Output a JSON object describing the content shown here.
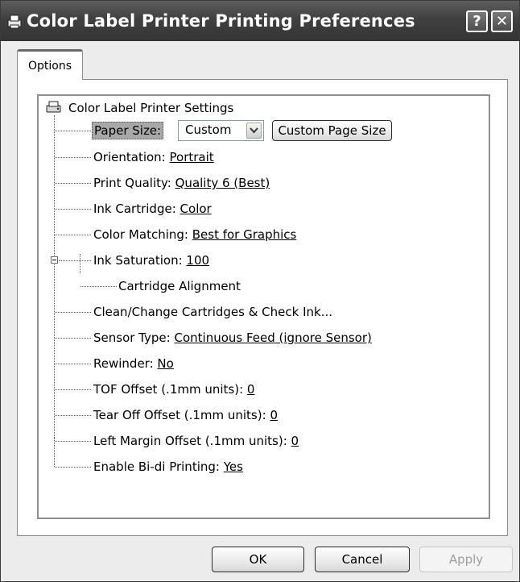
{
  "window": {
    "title": "Color Label Printer Printing Preferences",
    "help_button": "?",
    "close_button": "✕"
  },
  "tabs": [
    {
      "label": "Options",
      "active": true
    }
  ],
  "tree": {
    "root_label": "Color Label Printer Settings",
    "paper_size": {
      "label": "Paper Size:",
      "value": "Custom",
      "custom_button": "Custom Page Size"
    },
    "items": [
      {
        "label": "Orientation:",
        "value": "Portrait"
      },
      {
        "label": "Print Quality:",
        "value": "Quality 6 (Best)"
      },
      {
        "label": "Ink Cartridge:",
        "value": "Color"
      },
      {
        "label": "Color Matching:",
        "value": "Best for Graphics"
      },
      {
        "label": "Ink Saturation:",
        "value": "100"
      }
    ],
    "sub_item": "Cartridge Alignment",
    "items2": [
      {
        "label": "Clean/Change Cartridges & Check Ink...",
        "value": ""
      },
      {
        "label": "Sensor Type:",
        "value": "Continuous Feed (ignore Sensor)"
      },
      {
        "label": "Rewinder:",
        "value": "No"
      },
      {
        "label": "TOF Offset (.1mm units):",
        "value": "0"
      },
      {
        "label": "Tear Off Offset (.1mm units):",
        "value": "0"
      },
      {
        "label": "Left Margin Offset (.1mm units):",
        "value": "0"
      },
      {
        "label": "Enable Bi-di Printing:",
        "value": "Yes"
      }
    ]
  },
  "buttons": {
    "ok": "OK",
    "cancel": "Cancel",
    "apply": "Apply"
  }
}
